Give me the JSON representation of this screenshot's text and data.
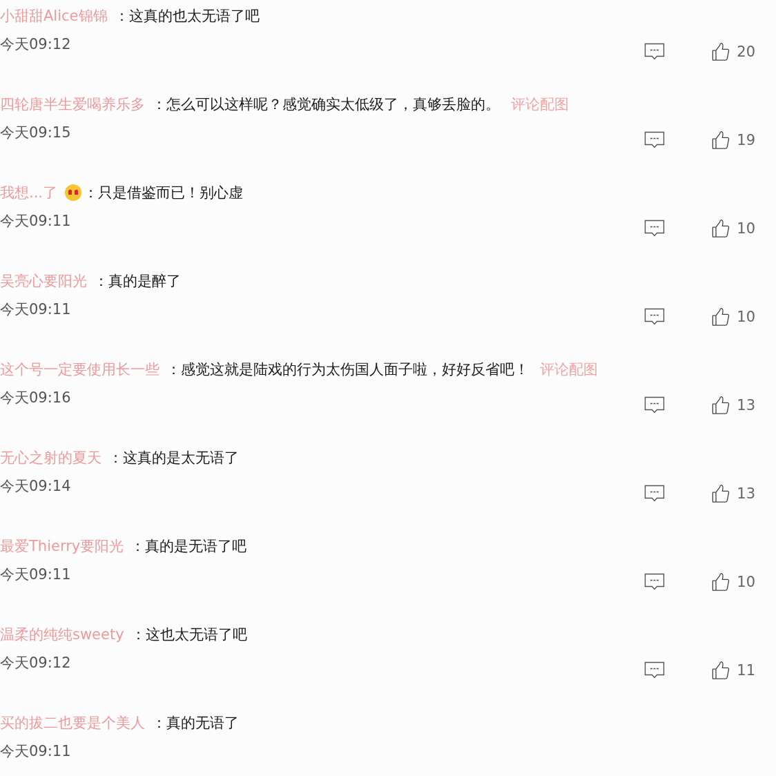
{
  "comments": [
    {
      "user": "小甜甜Alice锦锦",
      "text": "：这真的也太无语了吧",
      "time": "今天09:12",
      "likes": "20"
    },
    {
      "user": "四轮唐半生爱喝养乐多",
      "text": "：怎么可以这样呢？感觉确实太低级了，真够丢脸的。",
      "image_link": "评论配图",
      "time": "今天09:15",
      "likes": "19"
    },
    {
      "user": "我想...了",
      "badge": true,
      "text": "：只是借鉴而已！别心虚",
      "time": "今天09:11",
      "likes": "10"
    },
    {
      "user": "吴亮心要阳光",
      "text": "：真的是醉了",
      "time": "今天09:11",
      "likes": "10"
    },
    {
      "user": "这个号一定要使用长一些",
      "text": "：感觉这就是陆戏的行为太伤国人面子啦，好好反省吧！",
      "image_link": "评论配图",
      "time": "今天09:16",
      "likes": "13"
    },
    {
      "user": "无心之射的夏天",
      "text": "：这真的是太无语了",
      "time": "今天09:14",
      "likes": "13"
    },
    {
      "user": "最爱Thierry要阳光",
      "text": "：真的是无语了吧",
      "time": "今天09:11",
      "likes": "10"
    },
    {
      "user": "温柔的纯纯sweety",
      "text": "：这也太无语了吧",
      "time": "今天09:12",
      "likes": "11"
    },
    {
      "user": "买的拔二也要是个美人",
      "text": "：真的无语了",
      "time": "今天09:11"
    }
  ]
}
